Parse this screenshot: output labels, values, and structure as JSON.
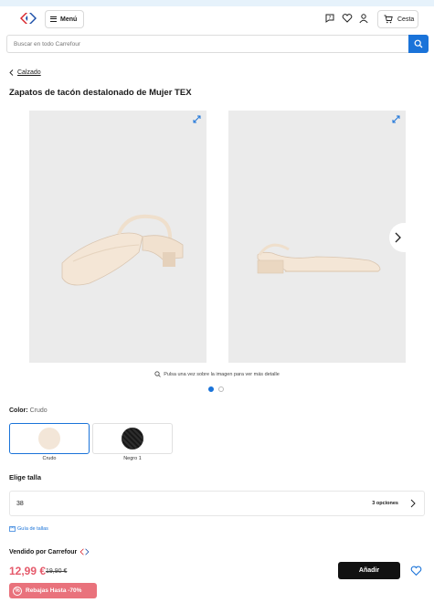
{
  "colors": {
    "accent": "#1a73d9",
    "price": "#e55a6b",
    "promo": "#e9727c",
    "image_bg": "#ebebeb"
  },
  "header": {
    "logo": "carrefour-logo",
    "menu_label": "Menú",
    "cart_label": "Cesta"
  },
  "search": {
    "placeholder": "Buscar en todo Carrefour"
  },
  "breadcrumb": {
    "back_label": "Calzado"
  },
  "product": {
    "title": "Zapatos de tacón destalonado de Mujer TEX",
    "image_hint": "Pulsa una vez sobre la imagen para ver más detalle",
    "images": [
      "shoe-front-view",
      "shoe-side-view"
    ],
    "active_image": 1,
    "image_count": 2
  },
  "color": {
    "label": "Color:",
    "selected": "Crudo",
    "options": [
      {
        "name": "Crudo",
        "hex": "#f3e6d8"
      },
      {
        "name": "Negro 1",
        "hex": "#222222"
      }
    ]
  },
  "size": {
    "label": "Elige talla",
    "value": "38",
    "options_count": "3 opciones",
    "guide_label": "Guía de tallas"
  },
  "purchase": {
    "seller_label": "Vendido por Carrefour",
    "price": "12,99 €",
    "old_price": "19,90 €",
    "add_label": "Añadir",
    "promo_label": "Rebajas Hasta -70%"
  }
}
